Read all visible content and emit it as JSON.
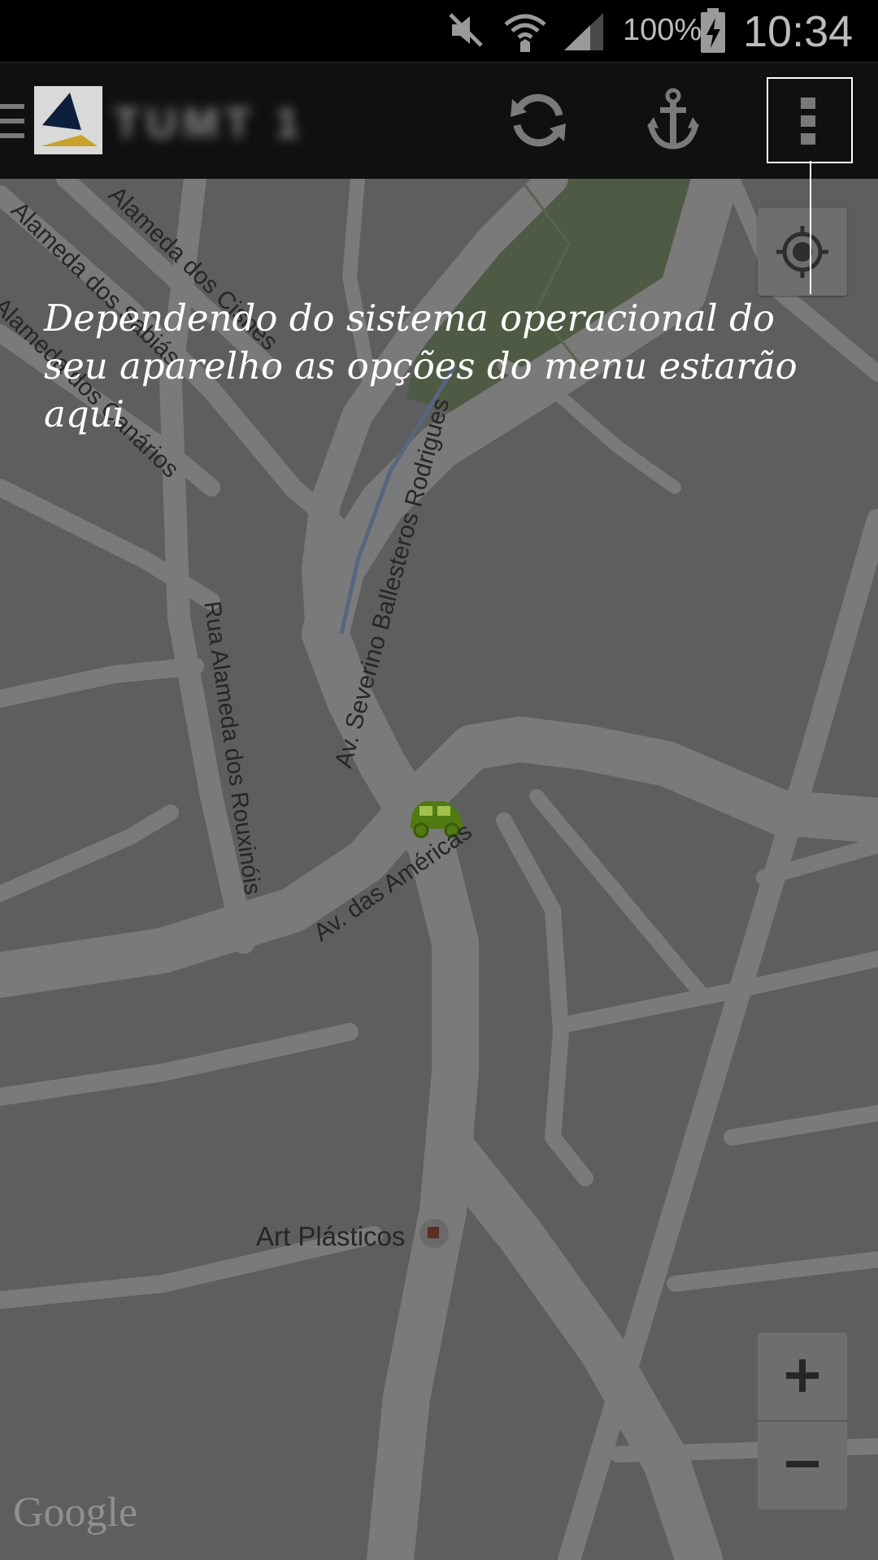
{
  "status_bar": {
    "icons": [
      "mute-icon",
      "wifi-icon",
      "signal-icon",
      "battery-charging-icon"
    ],
    "battery": "100%",
    "time": "10:34"
  },
  "action_bar": {
    "title_blurred": "TUMT 1",
    "buttons": [
      "refresh-icon",
      "anchor-icon",
      "overflow-menu-icon"
    ]
  },
  "map": {
    "street_labels": [
      "Alameda dos Cisnes",
      "Alameda dos Sabiás",
      "Alameda dos Canários",
      "Av. Severino Ballesteros Rodrigues",
      "Rua Alameda dos Rouxinóis",
      "Av. das Américas"
    ],
    "poi": "Art Plásticos",
    "attribution": "Google",
    "controls": {
      "zoom_in": "+",
      "zoom_out": "−"
    }
  },
  "overlay": {
    "tip": "Dependendo do sistema operacional do seu aparelho as opções do menu estarão aqui"
  }
}
